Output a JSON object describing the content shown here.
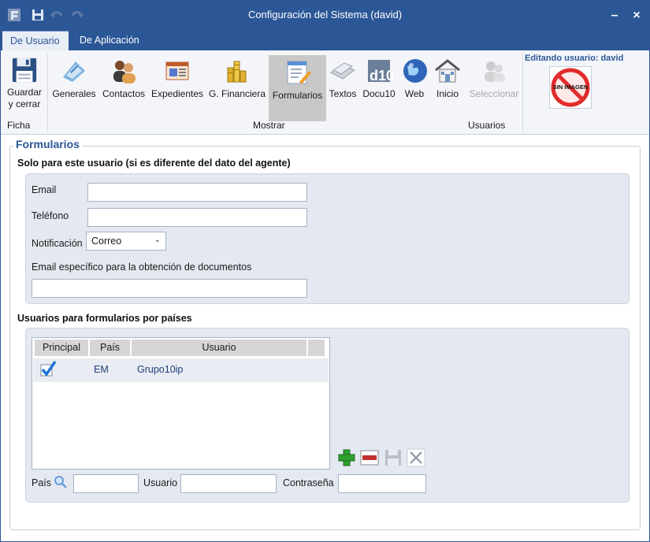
{
  "window": {
    "title": "Configuración del Sistema (david)",
    "minimize": "–",
    "close": "×"
  },
  "tabs": [
    {
      "label": "De Usuario",
      "active": true
    },
    {
      "label": "De Aplicación",
      "active": false
    }
  ],
  "ribbon": {
    "buttons": [
      {
        "label": "Guardar y cerrar",
        "icon": "floppy-icon"
      },
      {
        "label": "Generales",
        "icon": "generales-icon"
      },
      {
        "label": "Contactos",
        "icon": "contacts-icon"
      },
      {
        "label": "Expedientes",
        "icon": "expedientes-icon"
      },
      {
        "label": "G. Financiera",
        "icon": "coins-icon"
      },
      {
        "label": "Formularios",
        "icon": "forms-icon",
        "selected": true
      },
      {
        "label": "Textos",
        "icon": "texts-icon"
      },
      {
        "label": "Docu10",
        "icon": "docu10-icon"
      },
      {
        "label": "Web",
        "icon": "globe-icon"
      },
      {
        "label": "Inicio",
        "icon": "home-icon"
      },
      {
        "label": "Seleccionar",
        "icon": "users-icon",
        "disabled": true
      }
    ],
    "groups": {
      "ficha": "Ficha",
      "mostrar": "Mostrar",
      "usuarios": "Usuarios"
    },
    "editing_label": "Editando usuario: david",
    "no_image_text": "SIN IMAGEN"
  },
  "form": {
    "legend": "Formularios",
    "user_section_title": "Solo para este usuario (si es diferente del dato del agente)",
    "email_label": "Email",
    "email_value": "",
    "phone_label": "Teléfono",
    "phone_value": "",
    "notification_label": "Notificación",
    "notification_value": "Correo",
    "doc_email_label": "Email específico para la obtención de documentos",
    "doc_email_value": ""
  },
  "countries": {
    "section_title": "Usuarios para formularios por países",
    "columns": [
      "Principal",
      "País",
      "Usuario"
    ],
    "rows": [
      {
        "principal": true,
        "pais": "EM",
        "usuario": "Grupo10ip"
      }
    ],
    "pais_label": "País",
    "usuario_label": "Usuario",
    "password_label": "Contraseña"
  },
  "colors": {
    "titlebar": "#2b5797",
    "panel": "#e4e8f0",
    "selected_button": "#c8c8c8",
    "checkmark": "#1e73d8",
    "add": "#2da12d",
    "remove": "#c23030"
  }
}
